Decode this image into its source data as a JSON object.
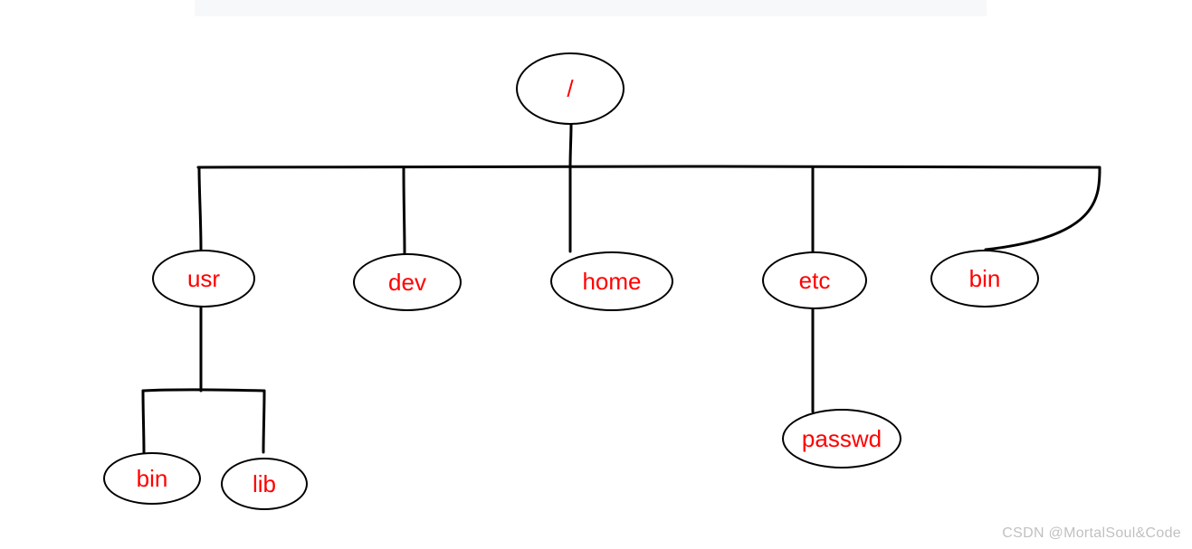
{
  "tree": {
    "root": {
      "label": "/"
    },
    "level2": {
      "usr": {
        "label": "usr"
      },
      "dev": {
        "label": "dev"
      },
      "home": {
        "label": "home"
      },
      "etc": {
        "label": "etc"
      },
      "bin": {
        "label": "bin"
      }
    },
    "usr_children": {
      "bin": {
        "label": "bin"
      },
      "lib": {
        "label": "lib"
      }
    },
    "etc_children": {
      "passwd": {
        "label": "passwd"
      }
    }
  },
  "watermark": "CSDN @MortalSoul&Code"
}
